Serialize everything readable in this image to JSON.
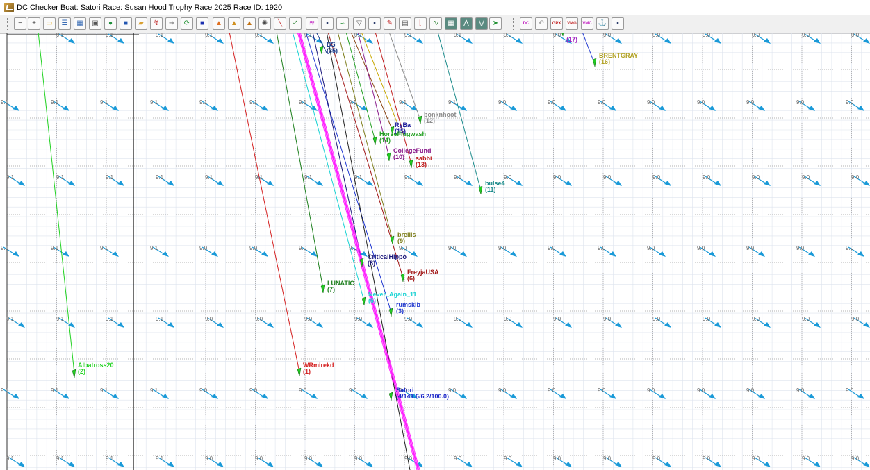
{
  "window": {
    "title": "DC Checker  Boat: Satori   Race: Susan Hood Trophy Race 2025   Race ID: 1920"
  },
  "toolbar": {
    "buttons": [
      {
        "name": "zoom-out-button",
        "glyph": "−",
        "color": "#444"
      },
      {
        "name": "zoom-in-button",
        "glyph": "+",
        "color": "#444"
      },
      {
        "name": "folder-light-button",
        "glyph": "▭",
        "color": "#e8c060"
      },
      {
        "name": "list-button",
        "glyph": "☰",
        "color": "#3a6db5"
      },
      {
        "name": "table-button",
        "glyph": "▦",
        "color": "#3a6db5"
      },
      {
        "name": "map-layer-button",
        "glyph": "▣",
        "color": "#555"
      },
      {
        "name": "globe-button",
        "glyph": "●",
        "color": "#1e8f3a"
      },
      {
        "name": "blue-square-button",
        "glyph": "■",
        "color": "#2155b0"
      },
      {
        "name": "open-folder-button",
        "glyph": "▰",
        "color": "#d9a030"
      },
      {
        "name": "line-tool-button",
        "glyph": "↯",
        "color": "#c03030"
      },
      {
        "name": "arrow-right-button",
        "glyph": "➜",
        "color": "#999"
      },
      {
        "name": "refresh-button",
        "glyph": "⟳",
        "color": "#1e9030"
      },
      {
        "name": "stop-button",
        "glyph": "■",
        "color": "#1a2fb0"
      },
      {
        "name": "warning-button",
        "glyph": "▲",
        "color": "#e07020"
      },
      {
        "name": "warning-a-button",
        "glyph": "▲",
        "color": "#d09020"
      },
      {
        "name": "warning-b-button",
        "glyph": "▲",
        "color": "#c07010"
      },
      {
        "name": "helm-button",
        "glyph": "✺",
        "color": "#444"
      },
      {
        "name": "pen-button",
        "glyph": "╲",
        "color": "#c02020"
      },
      {
        "name": "check-button",
        "glyph": "✓",
        "color": "#2a8030"
      },
      {
        "name": "info-button",
        "glyph": "≋",
        "color": "#c020c0"
      },
      {
        "name": "save-button",
        "glyph": "▪",
        "color": "#2a3a6a"
      },
      {
        "name": "route-button",
        "glyph": "≈",
        "color": "#1c8a2c"
      },
      {
        "name": "funnel-button",
        "glyph": "▽",
        "color": "#555"
      },
      {
        "name": "save-alt-button",
        "glyph": "▪",
        "color": "#2a3a6a"
      },
      {
        "name": "pencil-button",
        "glyph": "✎",
        "color": "#c02020"
      },
      {
        "name": "box-button",
        "glyph": "▤",
        "color": "#555"
      },
      {
        "name": "boat-button",
        "glyph": "⌊",
        "color": "#c02020"
      },
      {
        "name": "wave-button",
        "glyph": "∿",
        "color": "#2a8030"
      },
      {
        "name": "grid-button",
        "glyph": "▦",
        "color": "#fff",
        "bg": "#5a8a80"
      },
      {
        "name": "chart-button",
        "glyph": "⋀",
        "color": "#fff",
        "bg": "#5a8a80"
      },
      {
        "name": "chart-alt-button",
        "glyph": "⋁",
        "color": "#fff",
        "bg": "#5a8a80"
      },
      {
        "name": "go-button",
        "glyph": "➤",
        "color": "#1e9030"
      },
      {
        "name": "dc-button",
        "glyph": "DC",
        "color": "#c020c0"
      },
      {
        "name": "undo-button",
        "glyph": "↶",
        "color": "#999"
      },
      {
        "name": "gpx-button",
        "glyph": "GPX",
        "color": "#c02020"
      },
      {
        "name": "vmg-button",
        "glyph": "VMG",
        "color": "#c02020"
      },
      {
        "name": "vmc-button",
        "glyph": "VMC",
        "color": "#c020c0"
      },
      {
        "name": "fish-button",
        "glyph": "⚓",
        "color": "#c05020"
      },
      {
        "name": "save-final-button",
        "glyph": "▪",
        "color": "#2a3a6a"
      }
    ]
  },
  "map": {
    "wind_labels": [
      "9.1",
      "9.0"
    ],
    "boats": [
      {
        "name": "Albatross20",
        "rank": "(2)",
        "color": "#22d222"
      },
      {
        "name": "WRmirekd",
        "rank": "(1)",
        "color": "#d42020"
      },
      {
        "name": "LUNATIC",
        "rank": "(7)",
        "color": "#1d7f1d"
      },
      {
        "name": "Never_Again_11",
        "rank": "(5)",
        "color": "#19d3d3"
      },
      {
        "name": "rumskib",
        "rank": "(3)",
        "color": "#2038d0"
      },
      {
        "name": "CriticalHippo",
        "rank": "(8)",
        "color": "#18157a"
      },
      {
        "name": "FreyjaUSA",
        "rank": "(6)",
        "color": "#a01414"
      },
      {
        "name": "brellis",
        "rank": "(9)",
        "color": "#7d7d1a"
      },
      {
        "name": "Satori",
        "rank": "(4/141.6/6.2/100.0)",
        "color": "#1a26c8"
      },
      {
        "name": "RyBa",
        "rank": "(15)",
        "color": "#1a1a9c"
      },
      {
        "name": "HorseFlugwash",
        "rank": "(14)",
        "color": "#22a022"
      },
      {
        "name": "CollegeFund",
        "rank": "(10)",
        "color": "#8a1a8a"
      },
      {
        "name": "sabbi",
        "rank": "(13)",
        "color": "#c01a1a"
      },
      {
        "name": "bonknhoot",
        "rank": "(12)",
        "color": "#8a8a8a"
      },
      {
        "name": "bulse4",
        "rank": "(11)",
        "color": "#1a8a8a"
      },
      {
        "name": "BRENTGRAY",
        "rank": "(16)",
        "color": "#b0a020"
      },
      {
        "name": "BS",
        "rank": "(35)",
        "color": "#1a3a8a"
      },
      {
        "name": "",
        "rank": "(17)",
        "color": "#a020c0"
      }
    ]
  }
}
